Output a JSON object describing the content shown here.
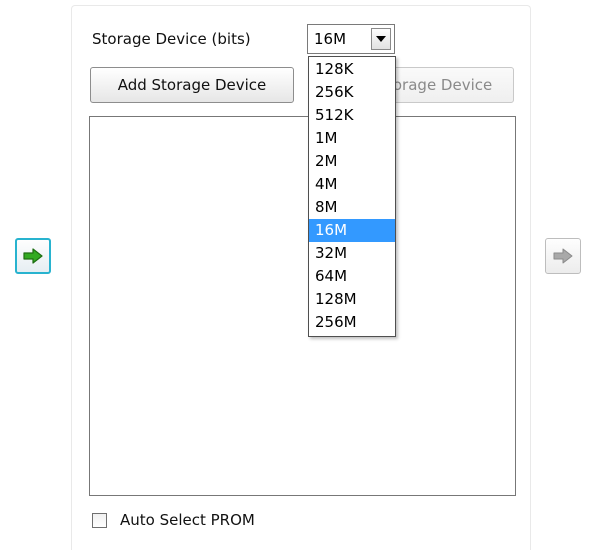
{
  "storage": {
    "label": "Storage Device (bits)",
    "selected_value": "16M",
    "options": [
      "128K",
      "256K",
      "512K",
      "1M",
      "2M",
      "4M",
      "8M",
      "16M",
      "32M",
      "64M",
      "128M",
      "256M"
    ]
  },
  "buttons": {
    "add_label": "Add Storage Device",
    "remove_label_visible": "torage Device"
  },
  "options_row": {
    "auto_select_label": "Auto Select PROM"
  },
  "icons": {
    "left_arrow": "arrow-right-green-icon",
    "right_arrow": "arrow-right-gray-icon"
  },
  "colors": {
    "selection_highlight": "#3399ff",
    "nav_left_border": "#28b3cf",
    "nav_left_arrow": "#33aa22",
    "nav_right_arrow": "#a9a9a9"
  }
}
